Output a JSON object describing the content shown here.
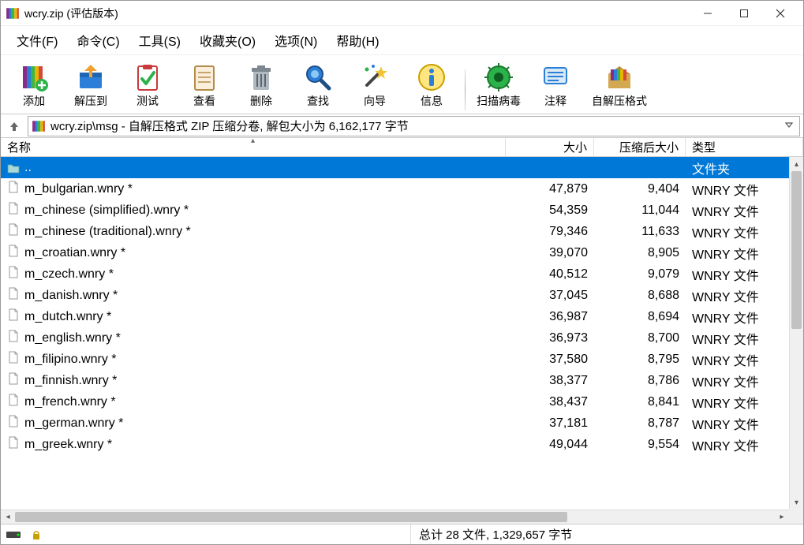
{
  "window": {
    "title": "wcry.zip (评估版本)"
  },
  "menus": {
    "file": "文件(F)",
    "commands": "命令(C)",
    "tools": "工具(S)",
    "favorites": "收藏夹(O)",
    "options": "选项(N)",
    "help": "帮助(H)"
  },
  "toolbar": {
    "add": "添加",
    "extract_to": "解压到",
    "test": "测试",
    "view": "查看",
    "delete": "删除",
    "find": "查找",
    "wizard": "向导",
    "info": "信息",
    "virus_scan": "扫描病毒",
    "comment": "注释",
    "sfx": "自解压格式"
  },
  "address": {
    "path": "wcry.zip\\msg - 自解压格式 ZIP 压缩分卷, 解包大小为 6,162,177 字节"
  },
  "columns": {
    "name": "名称",
    "size": "大小",
    "packed": "压缩后大小",
    "type": "类型"
  },
  "parent_row": {
    "name": "..",
    "type": "文件夹"
  },
  "files": [
    {
      "name": "m_bulgarian.wnry *",
      "size": "47,879",
      "packed": "9,404",
      "type": "WNRY 文件"
    },
    {
      "name": "m_chinese (simplified).wnry *",
      "size": "54,359",
      "packed": "11,044",
      "type": "WNRY 文件"
    },
    {
      "name": "m_chinese (traditional).wnry *",
      "size": "79,346",
      "packed": "11,633",
      "type": "WNRY 文件"
    },
    {
      "name": "m_croatian.wnry *",
      "size": "39,070",
      "packed": "8,905",
      "type": "WNRY 文件"
    },
    {
      "name": "m_czech.wnry *",
      "size": "40,512",
      "packed": "9,079",
      "type": "WNRY 文件"
    },
    {
      "name": "m_danish.wnry *",
      "size": "37,045",
      "packed": "8,688",
      "type": "WNRY 文件"
    },
    {
      "name": "m_dutch.wnry *",
      "size": "36,987",
      "packed": "8,694",
      "type": "WNRY 文件"
    },
    {
      "name": "m_english.wnry *",
      "size": "36,973",
      "packed": "8,700",
      "type": "WNRY 文件"
    },
    {
      "name": "m_filipino.wnry *",
      "size": "37,580",
      "packed": "8,795",
      "type": "WNRY 文件"
    },
    {
      "name": "m_finnish.wnry *",
      "size": "38,377",
      "packed": "8,786",
      "type": "WNRY 文件"
    },
    {
      "name": "m_french.wnry *",
      "size": "38,437",
      "packed": "8,841",
      "type": "WNRY 文件"
    },
    {
      "name": "m_german.wnry *",
      "size": "37,181",
      "packed": "8,787",
      "type": "WNRY 文件"
    },
    {
      "name": "m_greek.wnry *",
      "size": "49,044",
      "packed": "9,554",
      "type": "WNRY 文件"
    }
  ],
  "status": {
    "summary": "总计 28 文件, 1,329,657 字节"
  }
}
